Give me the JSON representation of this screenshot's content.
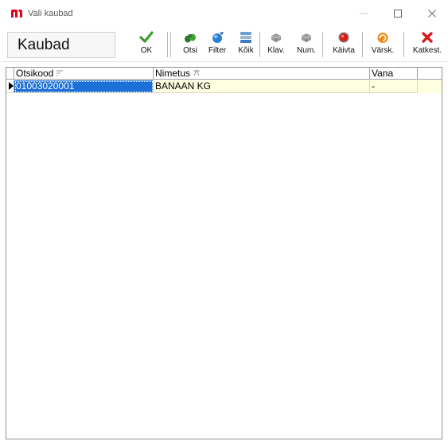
{
  "window": {
    "title": "Vali kaubad",
    "brand_color": "#e3001b"
  },
  "toolbar": {
    "form_title": "Kaubad",
    "buttons": {
      "ok": "OK",
      "search": "Otsi",
      "filter": "Filter",
      "all": "Kõik",
      "keyboard": "Klav.",
      "numpad": "Num.",
      "start": "Käivta",
      "refresh": "Värsk.",
      "cancel": "Katkest."
    }
  },
  "grid": {
    "columns": [
      "Otsikood",
      "Nimetus",
      "Vana"
    ],
    "rows": [
      {
        "code": "01003020001",
        "name": "BANAAN KG",
        "old": "-"
      }
    ],
    "selection_color": "#1b6fd6",
    "row_color": "#ffffe1"
  }
}
